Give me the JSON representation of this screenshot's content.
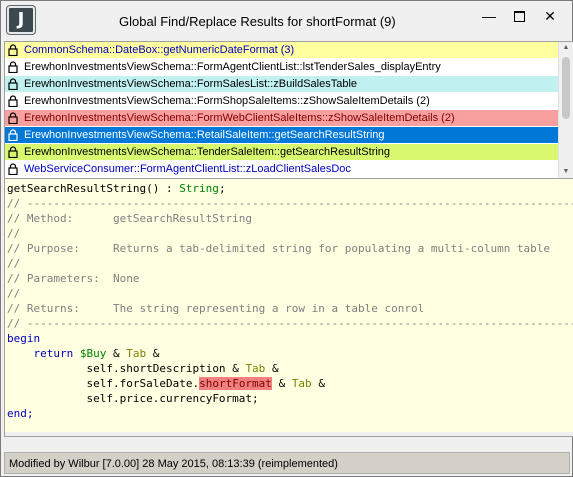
{
  "window": {
    "title": "Global Find/Replace Results for shortFormat (9)",
    "app_icon_letter": "J",
    "controls": {
      "minimize": "—",
      "close": "✕"
    }
  },
  "results": [
    {
      "text": "CommonSchema::DateBox::getNumericDateFormat (3)",
      "bg": "#ffffa0",
      "color": "#0000c0"
    },
    {
      "text": "ErewhonInvestmentsViewSchema::FormAgentClientList::lstTenderSales_displayEntry",
      "bg": "#ffffff",
      "color": "#000000"
    },
    {
      "text": "ErewhonInvestmentsViewSchema::FormSalesList::zBuildSalesTable",
      "bg": "#c0f0f0",
      "color": "#000000"
    },
    {
      "text": "ErewhonInvestmentsViewSchema::FormShopSaleItems::zShowSaleItemDetails (2)",
      "bg": "#ffffff",
      "color": "#000000"
    },
    {
      "text": "ErewhonInvestmentsViewSchema::FormWebClientSaleItems::zShowSaleItemDetails (2)",
      "bg": "#f8a0a0",
      "color": "#800000"
    },
    {
      "text": "ErewhonInvestmentsViewSchema::RetailSaleItem::getSearchResultString",
      "bg": "#0078d7",
      "color": "#ffffff"
    },
    {
      "text": "ErewhonInvestmentsViewSchema::TenderSaleItem::getSearchResultString",
      "bg": "#d8f870",
      "color": "#000000"
    },
    {
      "text": "WebServiceConsumer::FormAgentClientList::zLoadClientSalesDoc",
      "bg": "#ffffff",
      "color": "#0000c0"
    }
  ],
  "code": {
    "signature": "getSearchResultString() : ",
    "signature_type": "String",
    "signature_end": ";",
    "comment_rule": "// ----------------------------------------------------------------------------------------",
    "comment_blank": "//",
    "comment_method": "// Method:      getSearchResultString",
    "comment_purpose": "// Purpose:     Returns a tab-delimited string for populating a multi-column table",
    "comment_params": "// Parameters:  None",
    "comment_returns": "// Returns:     The string representing a row in a table conrol",
    "begin": "begin",
    "return_kw": "return",
    "buy": "$Buy",
    "amp": "&",
    "tab": "Tab",
    "line_desc": "self.shortDescription",
    "line_forsale": "self.forSaleDate.",
    "hit": "shortFormat",
    "line_price": "self.price.currencyFormat;",
    "end": "end;"
  },
  "status": {
    "text": "Modified by Wilbur [7.0.00] 28 May 2015, 08:13:39 (reimplemented)"
  }
}
